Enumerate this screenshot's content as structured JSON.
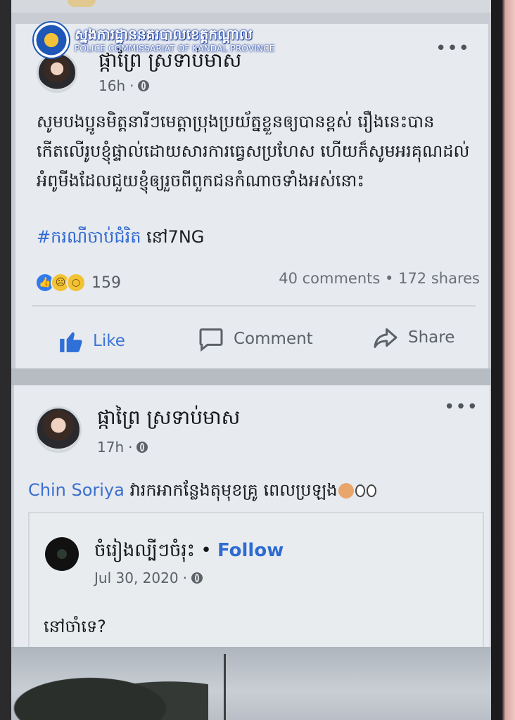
{
  "watermark": {
    "title_kh": "ស្នងការដ្ឋាននគរបាលខេត្តកណ្ដាល",
    "title_en": "POLICE COMMISSARIAT OF KANDAL PROVINCE"
  },
  "post1": {
    "author": "ផ្កាព្រៃ ស្រទាប់មាស",
    "time": "16h",
    "body": "សូមបងប្អូនមិត្តនារីៗមេត្តាប្រុងប្រយ័ត្នខ្លួនឲ្យបានខ្ពស់ រឿងនេះបានកើតលើរូបខ្ញុំផ្ទាល់ដោយសារការធ្វេសប្រហែស ហើយក៏សូមអរគុណដល់អំពូមីងដែលជួយខ្ញុំឲ្យរួចពីពួកជនកំណាចទាំងអស់នោះ",
    "hashtag": "#ករណីចាប់ជំរិត",
    "hashtag_rest": "នៅ7NG",
    "reaction_count": "159",
    "comments": "40 comments",
    "shares": "172 shares",
    "separator": "•",
    "more": "•••"
  },
  "actions": {
    "like": "Like",
    "comment": "Comment",
    "share": "Share"
  },
  "post2": {
    "author": "ផ្កាព្រៃ ស្រទាប់មាស",
    "time": "17h",
    "mention": "Chin Soriya",
    "text": "វារកអាកន្លែងតុមុខគ្រូ ពេលប្រឡង",
    "more": "•••",
    "shared": {
      "page_name": "ចំរៀងល្បីៗចំរុះ",
      "separator": "•",
      "follow": "Follow",
      "date": "Jul 30, 2020",
      "dot": "·",
      "text": "នៅចាំទេ?"
    }
  },
  "icons": {
    "like": "thumbs-up-icon",
    "comment": "comment-bubble-icon",
    "share": "share-arrow-icon",
    "privacy": "globe-icon"
  }
}
